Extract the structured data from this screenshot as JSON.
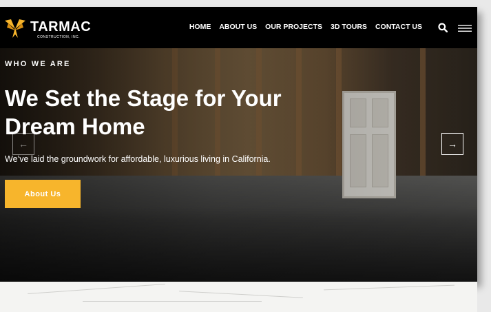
{
  "site": {
    "brand_name": "TARMAC",
    "brand_tagline": "CONSTRUCTION, INC."
  },
  "nav": {
    "items": [
      {
        "label": "HOME"
      },
      {
        "label": "ABOUT US"
      },
      {
        "label": "OUR PROJECTS"
      },
      {
        "label": "3D TOURS"
      },
      {
        "label": "CONTACT US"
      }
    ],
    "search_icon": "search-icon",
    "menu_icon": "hamburger-menu-icon"
  },
  "hero": {
    "eyebrow": "WHO WE ARE",
    "headline": "We Set the Stage for Your Dream Home",
    "subtext": "We’ve laid the groundwork for affordable, luxurious living in California.",
    "cta_label": "About Us",
    "prev_arrow": "←",
    "next_arrow": "→"
  },
  "colors": {
    "accent": "#f7b52c",
    "header_bg": "#000000",
    "text": "#ffffff"
  }
}
